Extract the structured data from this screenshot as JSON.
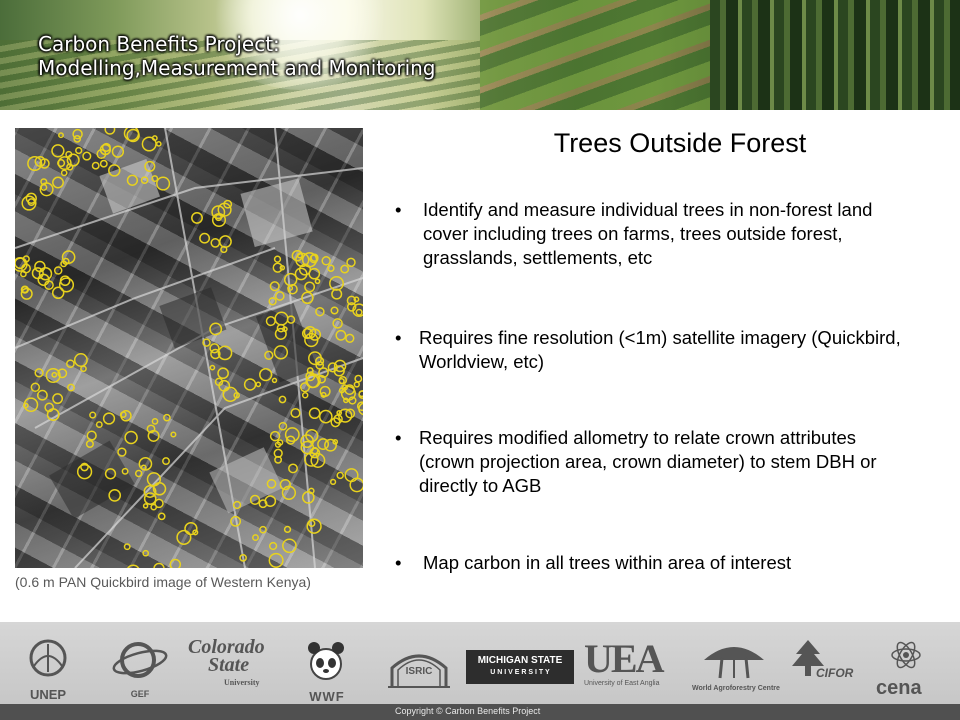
{
  "banner": {
    "title_line1": "Carbon Benefits Project:",
    "title_line2": "Modelling,Measurement and Monitoring"
  },
  "slide": {
    "title": "Trees Outside Forest",
    "image_caption": "(0.6 m PAN Quickbird image of Western Kenya)",
    "bullet_symbol": "•",
    "bullets": [
      "Identify and measure individual trees in non-forest land cover including trees on farms, trees outside forest, grasslands, settlements, etc",
      "Requires fine resolution (<1m) satellite imagery (Quickbird, Worldview, etc)",
      "Requires modified allometry to relate crown attributes (crown projection area, crown diameter) to stem DBH or directly to AGB",
      "Map carbon in all trees within area of interest"
    ]
  },
  "footer": {
    "logos": {
      "unep": "UNEP",
      "gef": "GEF",
      "colorado_1": "Colorado",
      "colorado_2": "State",
      "colorado_3": "University",
      "wwf": "WWF",
      "isric": "ISRIC",
      "msu_1": "MICHIGAN STATE",
      "msu_2": "U N I V E R S I T Y",
      "uea": "UEA",
      "uea_sub": "University of East Anglia",
      "icraf": "World Agroforestry Centre",
      "cifor": "CIFOR",
      "cena": "cena"
    },
    "copyright": "Copyright © Carbon Benefits Project"
  },
  "colors": {
    "tree_marker": "#e8d21e",
    "caption_text": "#595959",
    "footer_bg": "#c9c9c9"
  }
}
